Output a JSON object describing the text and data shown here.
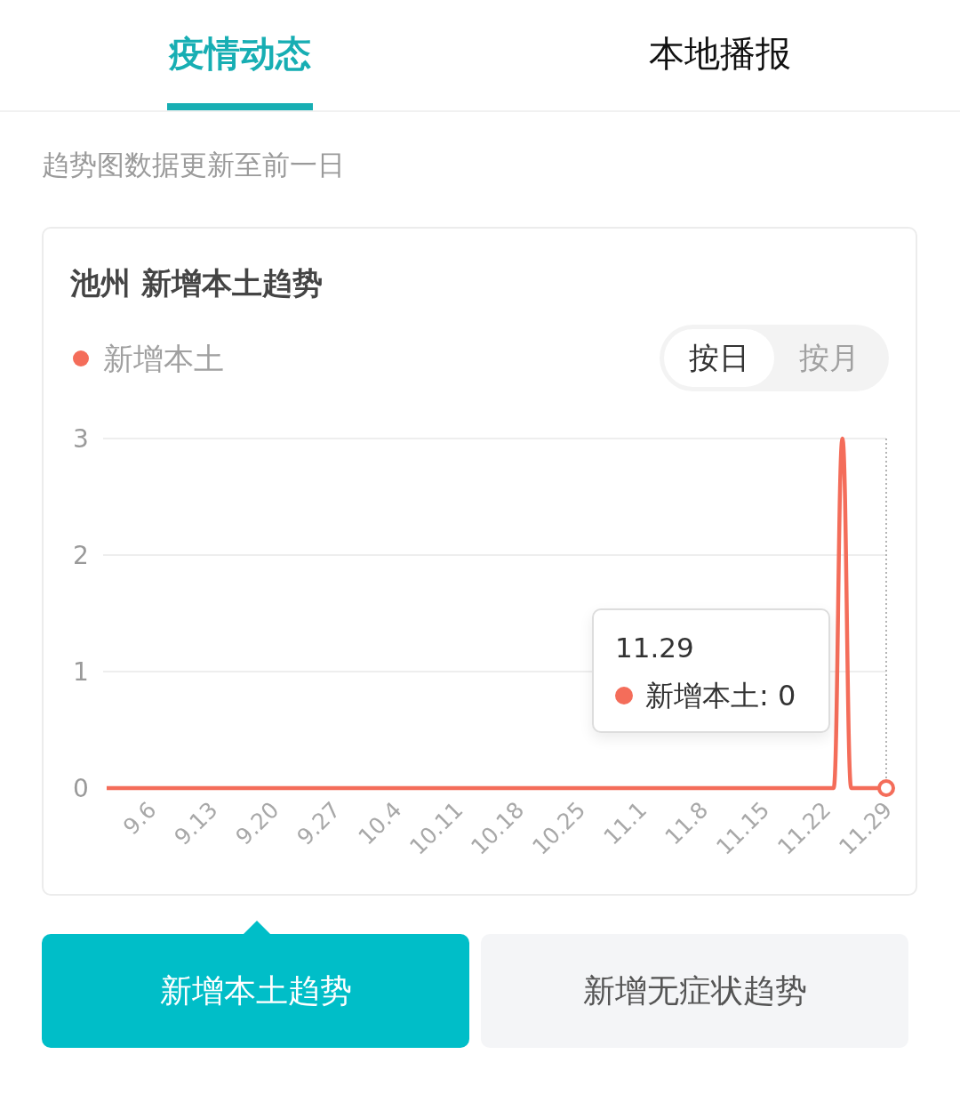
{
  "tabs": [
    {
      "label": "疫情动态",
      "selected": true
    },
    {
      "label": "本地播报",
      "selected": false
    }
  ],
  "note": "趋势图数据更新至前一日",
  "card": {
    "title": "池州 新增本土趋势",
    "period_toggle": [
      {
        "label": "按日",
        "selected": true
      },
      {
        "label": "按月",
        "selected": false
      }
    ],
    "chart_data": {
      "type": "line",
      "categories": [
        null,
        null,
        null,
        null,
        null,
        "9.6",
        null,
        null,
        null,
        null,
        null,
        null,
        "9.13",
        null,
        null,
        null,
        null,
        null,
        null,
        "9.20",
        null,
        null,
        null,
        null,
        null,
        null,
        "9.27",
        null,
        null,
        null,
        null,
        null,
        null,
        "10.4",
        null,
        null,
        null,
        null,
        null,
        null,
        "10.11",
        null,
        null,
        null,
        null,
        null,
        null,
        "10.18",
        null,
        null,
        null,
        null,
        null,
        null,
        "10.25",
        null,
        null,
        null,
        null,
        null,
        null,
        "11.1",
        null,
        null,
        null,
        null,
        null,
        null,
        "11.8",
        null,
        null,
        null,
        null,
        null,
        null,
        "11.15",
        null,
        null,
        null,
        null,
        null,
        null,
        "11.22",
        null,
        null,
        null,
        null,
        null,
        null,
        "11.29"
      ],
      "series": [
        {
          "name": "新增本土",
          "color": "#f46d5a",
          "values": [
            0,
            0,
            0,
            0,
            0,
            0,
            0,
            0,
            0,
            0,
            0,
            0,
            0,
            0,
            0,
            0,
            0,
            0,
            0,
            0,
            0,
            0,
            0,
            0,
            0,
            0,
            0,
            0,
            0,
            0,
            0,
            0,
            0,
            0,
            0,
            0,
            0,
            0,
            0,
            0,
            0,
            0,
            0,
            0,
            0,
            0,
            0,
            0,
            0,
            0,
            0,
            0,
            0,
            0,
            0,
            0,
            0,
            0,
            0,
            0,
            0,
            0,
            0,
            0,
            0,
            0,
            0,
            0,
            0,
            0,
            0,
            0,
            0,
            0,
            0,
            0,
            0,
            0,
            0,
            0,
            0,
            0,
            0,
            0,
            3,
            0,
            0,
            0,
            0,
            0
          ]
        }
      ],
      "ylim": [
        0,
        3
      ],
      "yticks": [
        0,
        1,
        2,
        3
      ]
    },
    "tooltip": {
      "title": "11.29",
      "label": "新增本土: 0"
    }
  },
  "trend_tabs": [
    {
      "label": "新增本土趋势",
      "selected": true
    },
    {
      "label": "新增无症状趋势",
      "selected": false
    }
  ]
}
